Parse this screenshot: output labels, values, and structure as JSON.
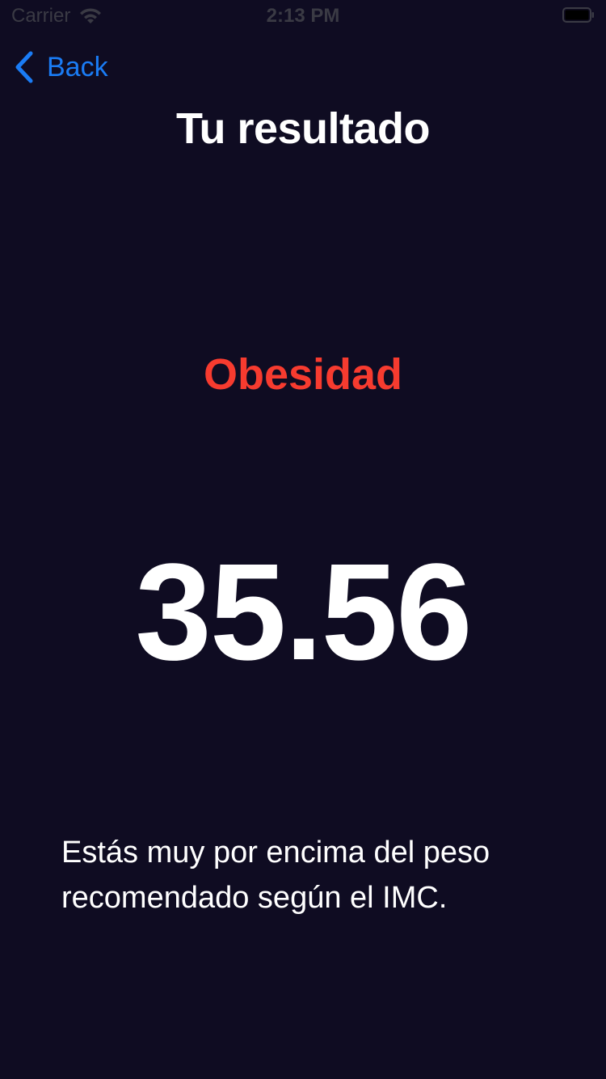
{
  "status_bar": {
    "carrier": "Carrier",
    "time": "2:13 PM",
    "icons": [
      "wifi-icon",
      "battery-icon"
    ]
  },
  "nav": {
    "back_label": "Back",
    "back_icon": "chevron-left-icon"
  },
  "header": {
    "title": "Tu resultado"
  },
  "result": {
    "category": "Obesidad",
    "value": "35.56",
    "advice": "Estás muy por encima del peso recomendado según el IMC."
  },
  "colors": {
    "background": "#0f0c22",
    "accent": "#1a7cf5",
    "category": "#f73b2f",
    "text": "#ffffff"
  }
}
